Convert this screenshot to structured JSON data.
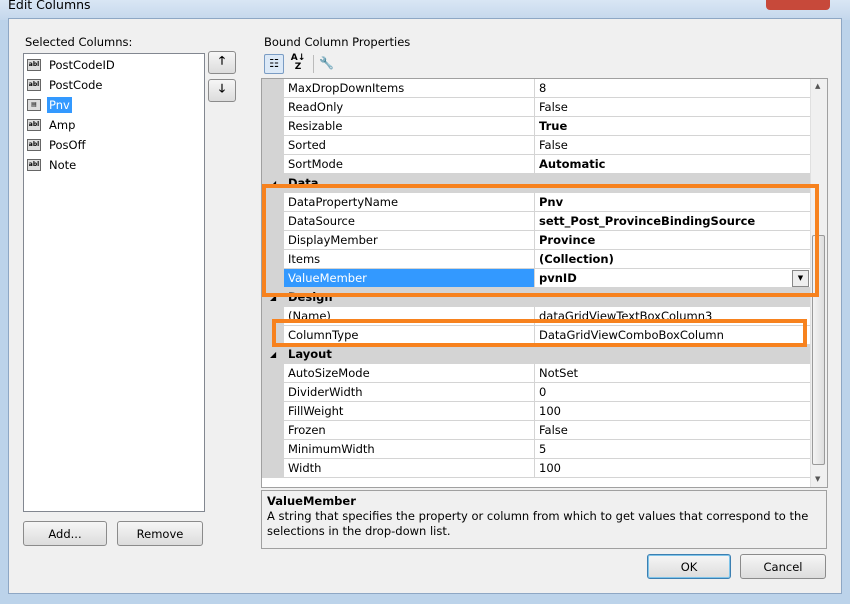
{
  "window": {
    "title": "Edit Columns"
  },
  "left": {
    "label": "Selected Columns:",
    "items": [
      {
        "label": "PostCodeID",
        "icon": "textbox-column-icon"
      },
      {
        "label": "PostCode",
        "icon": "textbox-column-icon"
      },
      {
        "label": "Pnv",
        "icon": "combobox-column-icon",
        "selected": true
      },
      {
        "label": "Amp",
        "icon": "textbox-column-icon"
      },
      {
        "label": "PosOff",
        "icon": "textbox-column-icon"
      },
      {
        "label": "Note",
        "icon": "textbox-column-icon"
      }
    ],
    "add": "Add...",
    "remove": "Remove",
    "up": "🡑",
    "down": "🡓",
    "abl": "abl"
  },
  "right": {
    "label": "Bound Column Properties",
    "rows": [
      {
        "type": "prop",
        "name": "MaxDropDownItems",
        "value": "8"
      },
      {
        "type": "prop",
        "name": "ReadOnly",
        "value": "False"
      },
      {
        "type": "prop",
        "name": "Resizable",
        "value": "True",
        "bold": true
      },
      {
        "type": "prop",
        "name": "Sorted",
        "value": "False"
      },
      {
        "type": "prop",
        "name": "SortMode",
        "value": "Automatic",
        "bold": true
      },
      {
        "type": "cat",
        "name": "Data"
      },
      {
        "type": "prop",
        "name": "DataPropertyName",
        "value": "Pnv",
        "bold": true
      },
      {
        "type": "prop",
        "name": "DataSource",
        "value": "sett_Post_ProvinceBindingSource",
        "bold": true
      },
      {
        "type": "prop",
        "name": "DisplayMember",
        "value": "Province",
        "bold": true
      },
      {
        "type": "prop",
        "name": "Items",
        "value": "(Collection)",
        "bold": true
      },
      {
        "type": "prop",
        "name": "ValueMember",
        "value": "pvnID",
        "bold": true,
        "selected": true
      },
      {
        "type": "cat",
        "name": "Design"
      },
      {
        "type": "prop",
        "name": "(Name)",
        "value": "dataGridViewTextBoxColumn3"
      },
      {
        "type": "prop",
        "name": "ColumnType",
        "value": "DataGridViewComboBoxColumn"
      },
      {
        "type": "cat",
        "name": "Layout"
      },
      {
        "type": "prop",
        "name": "AutoSizeMode",
        "value": "NotSet"
      },
      {
        "type": "prop",
        "name": "DividerWidth",
        "value": "0"
      },
      {
        "type": "prop",
        "name": "FillWeight",
        "value": "100"
      },
      {
        "type": "prop",
        "name": "Frozen",
        "value": "False"
      },
      {
        "type": "prop",
        "name": "MinimumWidth",
        "value": "5"
      },
      {
        "type": "prop",
        "name": "Width",
        "value": "100"
      }
    ],
    "description": {
      "title": "ValueMember",
      "text": "A string that specifies the property or column from which to get values that correspond to the selections in the drop-down list."
    }
  },
  "footer": {
    "ok": "OK",
    "cancel": "Cancel"
  },
  "colors": {
    "highlight": "#f7821e",
    "selection": "#3399ff"
  }
}
